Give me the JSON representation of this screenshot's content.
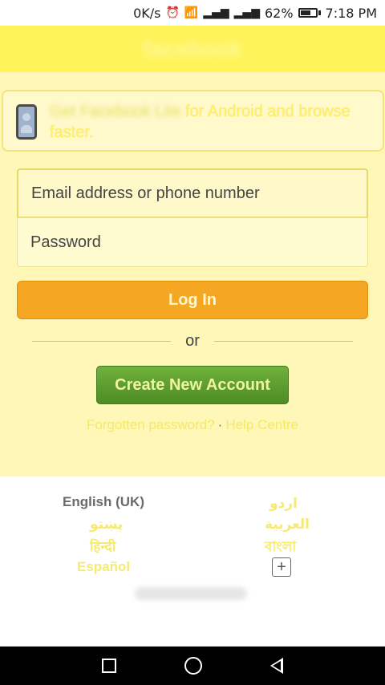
{
  "status_bar": {
    "network_speed": "0K/s",
    "battery_percent": "62%",
    "time": "7:18 PM",
    "icons": [
      "alarm-icon",
      "wifi-icon",
      "signal-icon",
      "signal-icon",
      "battery-icon"
    ]
  },
  "header": {
    "logo_text": "facebook"
  },
  "banner": {
    "blurred_link": "Get Facebook Lite",
    "text_suffix": " for Android and browse faster.",
    "icon": "phone-icon"
  },
  "login_form": {
    "email_placeholder": "Email address or phone number",
    "password_placeholder": "Password",
    "login_label": "Log In",
    "or_label": "or",
    "create_account_label": "Create New Account",
    "forgotten_password_label": "Forgotten password?",
    "separator": "·",
    "help_centre_label": "Help Centre"
  },
  "languages": {
    "current": "English (UK)",
    "left": [
      "پښتو",
      "हिन्दी",
      "Español"
    ],
    "right": [
      "اردو",
      "العربية",
      "বাংলা"
    ],
    "more_label": "+"
  },
  "nav_bar": {
    "icons": [
      "recent-apps-icon",
      "home-icon",
      "back-icon"
    ]
  },
  "colors": {
    "header_bg": "#fff35a",
    "page_bg": "#fff7b8",
    "login_button": "#f5a623",
    "create_button": "#5a9e2f"
  }
}
